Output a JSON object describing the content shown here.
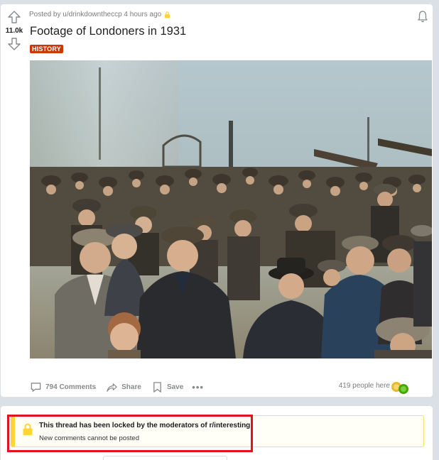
{
  "post": {
    "score": "11.0k",
    "posted_by": "Posted by u/drinkdowntheccp 4 hours ago",
    "title": "Footage of Londoners in 1931",
    "flair": "HISTORY",
    "comments_label": "794 Comments",
    "share_label": "Share",
    "save_label": "Save",
    "more_label": "•••",
    "people_here": "419 people here"
  },
  "locked": {
    "title": "This thread has been locked by the moderators of r/interesting",
    "subtitle": "New comments cannot be posted"
  },
  "icons": {
    "upvote": "arrow-up-icon",
    "downvote": "arrow-down-icon",
    "lock": "lock-icon",
    "bell": "bell-icon",
    "comment": "comment-icon",
    "share": "share-icon",
    "save": "bookmark-icon",
    "award": "award-icon"
  },
  "colors": {
    "flair": "#cc3600",
    "lock_accent": "#ffd635",
    "highlight_outline": "#e0141e"
  }
}
